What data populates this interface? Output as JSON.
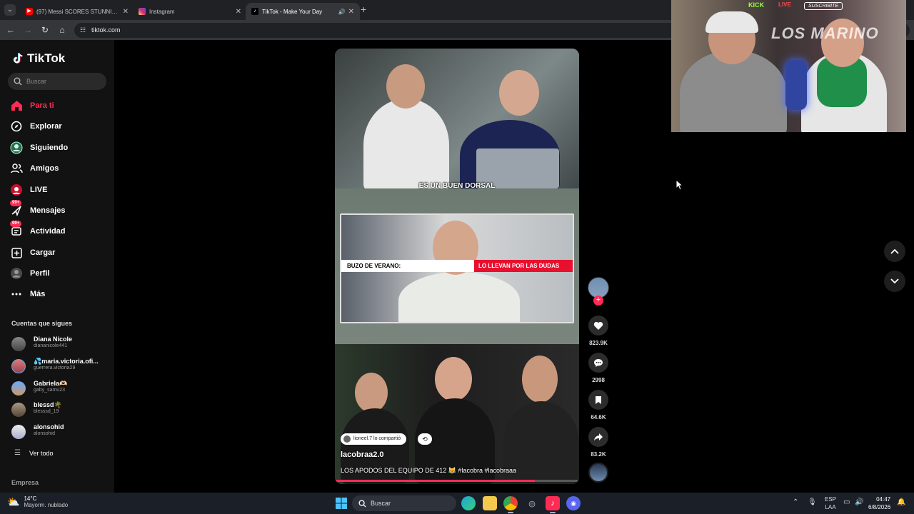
{
  "browser": {
    "tabs": [
      {
        "title": "(97) Messi SCORES STUNNING",
        "favicon": "youtube-icon",
        "color": "#ff0000"
      },
      {
        "title": "Instagram",
        "favicon": "instagram-icon",
        "color": "#d62976"
      },
      {
        "title": "TikTok - Make Your Day",
        "favicon": "tiktok-icon",
        "color": "#ffffff"
      }
    ],
    "url": "tiktok.com"
  },
  "sidebar": {
    "brand": "TikTok",
    "search_placeholder": "Buscar",
    "nav": [
      {
        "label": "Para ti",
        "icon": "home-icon",
        "active": true
      },
      {
        "label": "Explorar",
        "icon": "compass-icon"
      },
      {
        "label": "Siguiendo",
        "icon": "following-icon"
      },
      {
        "label": "Amigos",
        "icon": "friends-icon"
      },
      {
        "label": "LIVE",
        "icon": "live-icon"
      },
      {
        "label": "Mensajes",
        "icon": "messages-icon",
        "badge": "99+"
      },
      {
        "label": "Actividad",
        "icon": "activity-icon",
        "badge": "99+"
      },
      {
        "label": "Cargar",
        "icon": "upload-icon"
      },
      {
        "label": "Perfil",
        "icon": "profile-icon"
      },
      {
        "label": "Más",
        "icon": "more-icon"
      }
    ],
    "following_title": "Cuentas que sigues",
    "accounts": [
      {
        "name": "Diana Nicole",
        "handle": "diananicole441"
      },
      {
        "name": "💦maria.victoria.ofi...",
        "handle": "guerrera.victoria29"
      },
      {
        "name": "Gabriela🫶🏻",
        "handle": "gaby_samu23"
      },
      {
        "name": "blessd🌴",
        "handle": "blesssd_19"
      },
      {
        "name": "alonsohid",
        "handle": "alonsohid"
      }
    ],
    "see_all": "Ver todo",
    "company": "Empresa"
  },
  "video": {
    "caption_top": "ES UN BUEN DORSAL",
    "card_left": "BUZO DE VERANO:",
    "card_right": "LO LLEVAN POR LAS DUDAS",
    "shared_by": "lioneel.7 lo compartió",
    "author": "lacobraa2.0",
    "description": "LOS APODOS DEL EQUIPO DE 412 😹 #lacobra #lacobraaa",
    "progress": 0.82
  },
  "actions": {
    "likes": "823.9K",
    "comments": "2998",
    "saves": "64.6K",
    "shares": "83.2K"
  },
  "stream": {
    "brand": "KICK",
    "live": "LIVE",
    "subscribe": "SUSCRIBITE",
    "title": "LOS MARINO"
  },
  "taskbar": {
    "temp": "14°C",
    "weather": "Mayorm. nublado",
    "search": "Buscar",
    "lang_top": "ESP",
    "lang_bottom": "LAA",
    "time": "04:47",
    "date": "6/8/2026"
  },
  "colors": {
    "accent": "#fe2c55",
    "live_red": "#e8102e"
  }
}
